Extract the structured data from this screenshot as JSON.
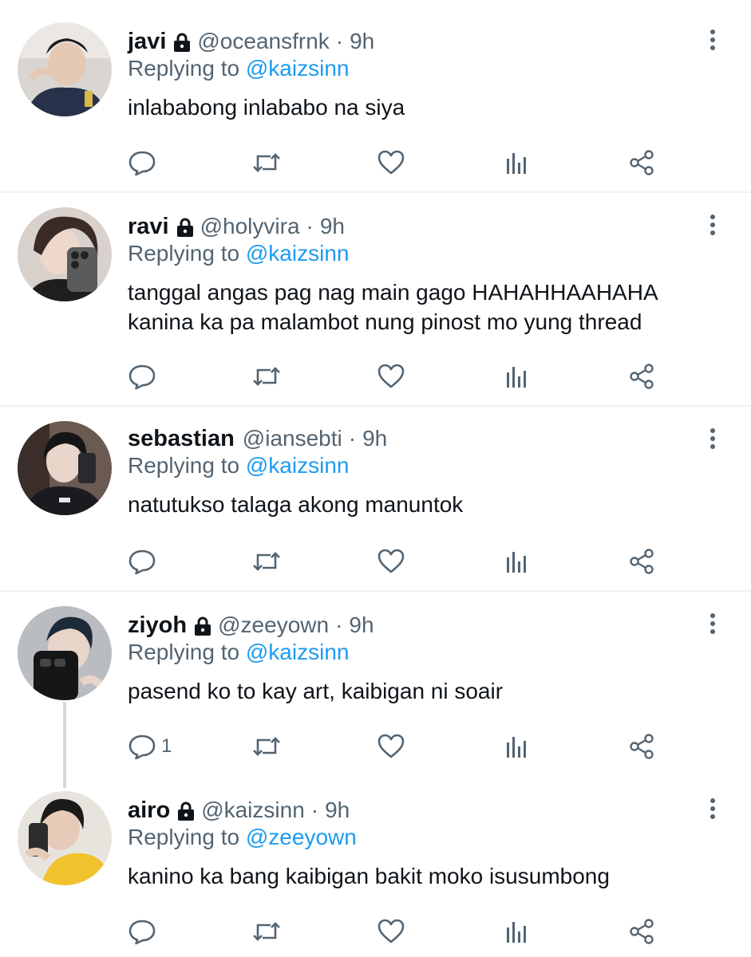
{
  "colors": {
    "accent": "#1d9bf0",
    "secondary": "#536471",
    "primary": "#0f1419",
    "divider": "#eff3f4"
  },
  "tweets": [
    {
      "name": "javi",
      "locked": true,
      "handle": "@oceansfrnk",
      "separator": "·",
      "time": "9h",
      "replying_prefix": "Replying to",
      "replying_to": "@kaizsinn",
      "lines": [
        "inlababong inlababo na siya"
      ],
      "reply_count": ""
    },
    {
      "name": "ravi",
      "locked": true,
      "handle": "@holyvira",
      "separator": "·",
      "time": "9h",
      "replying_prefix": "Replying to",
      "replying_to": "@kaizsinn",
      "lines": [
        "tanggal angas pag nag main gago HAHAHHAAHAHA",
        "kanina ka pa malambot nung pinost mo yung thread"
      ],
      "reply_count": ""
    },
    {
      "name": "sebastian",
      "locked": false,
      "handle": "@iansebti",
      "separator": "·",
      "time": "9h",
      "replying_prefix": "Replying to",
      "replying_to": "@kaizsinn",
      "lines": [
        "natutukso talaga akong manuntok"
      ],
      "reply_count": ""
    },
    {
      "name": "ziyoh",
      "locked": true,
      "handle": "@zeeyown",
      "separator": "·",
      "time": "9h",
      "replying_prefix": "Replying to",
      "replying_to": "@kaizsinn",
      "lines": [
        "pasend ko to kay art, kaibigan ni soair"
      ],
      "reply_count": "1"
    },
    {
      "name": "airo",
      "locked": true,
      "handle": "@kaizsinn",
      "separator": "·",
      "time": "9h",
      "replying_prefix": "Replying to",
      "replying_to": "@zeeyown",
      "lines": [
        "kanino ka bang kaibigan bakit moko isusumbong"
      ],
      "reply_count": ""
    }
  ],
  "icons": {
    "reply": "reply-icon",
    "retweet": "retweet-icon",
    "like": "heart-icon",
    "views": "views-icon",
    "share": "share-icon",
    "more": "more-vertical-icon",
    "lock": "lock-icon"
  }
}
